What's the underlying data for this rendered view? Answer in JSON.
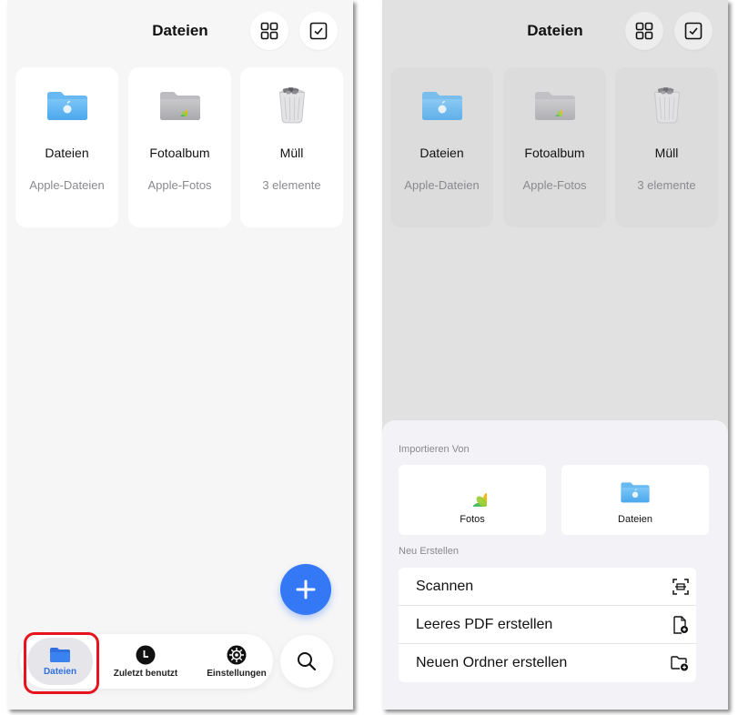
{
  "title": "Dateien",
  "cards": [
    {
      "title": "Dateien",
      "subtitle": "Apple-Dateien",
      "icon": "blue-folder-icon"
    },
    {
      "title": "Fotoalbum",
      "subtitle": "Apple-Fotos",
      "icon": "gray-folder-photos-icon"
    },
    {
      "title": "Müll",
      "subtitle": "3 elemente",
      "icon": "trash-can-icon"
    }
  ],
  "tabbar": {
    "files": "Dateien",
    "recent": "Zuletzt benutzt",
    "settings": "Einstellungen"
  },
  "sheet": {
    "import_heading": "Importieren Von",
    "import_options": [
      {
        "label": "Fotos",
        "icon": "photos-app-icon"
      },
      {
        "label": "Dateien",
        "icon": "blue-folder-icon"
      }
    ],
    "create_heading": "Neu Erstellen",
    "actions": [
      {
        "label": "Scannen",
        "icon": "scan-icon"
      },
      {
        "label": "Leeres PDF erstellen",
        "icon": "new-document-icon"
      },
      {
        "label": "Neuen Ordner erstellen",
        "icon": "new-folder-icon"
      }
    ]
  },
  "colors": {
    "accent": "#3478f6",
    "highlight": "#e8141d",
    "folder_blue": "#5db6f2"
  }
}
